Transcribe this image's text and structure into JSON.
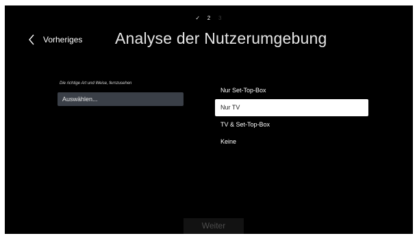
{
  "stepper": {
    "step1": "✓",
    "step2": "2",
    "step3": "3"
  },
  "header": {
    "back_label": "Vorheriges",
    "title": "Analyse der Nutzerumgebung"
  },
  "form": {
    "label": "Die richtige Art und Weise, fernzusehen",
    "select_value": "Auswählen..."
  },
  "options": [
    {
      "label": "Nur Set-Top-Box",
      "selected": false
    },
    {
      "label": "Nur TV",
      "selected": true
    },
    {
      "label": "TV & Set-Top-Box",
      "selected": false
    },
    {
      "label": "Keine",
      "selected": false
    }
  ],
  "footer": {
    "next_label": "Weiter"
  },
  "icons": {
    "back": "chevron-left-icon",
    "step_done": "check-icon"
  },
  "colors": {
    "background": "#000000",
    "select_bg": "#3a3f47",
    "highlight": "#ffffff",
    "disabled_text": "#4d4d4d"
  }
}
